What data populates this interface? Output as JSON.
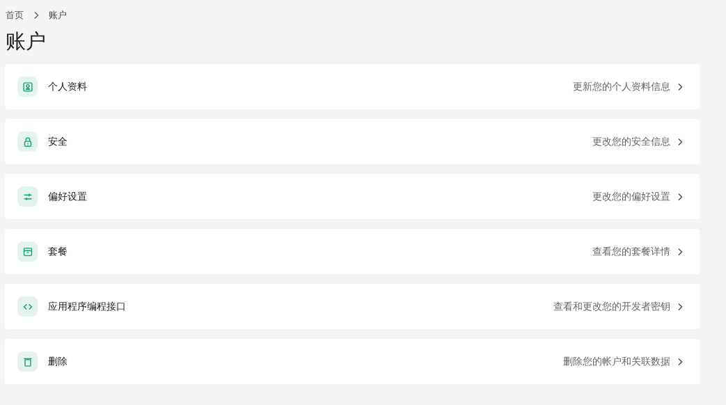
{
  "breadcrumb": [
    "首页",
    "账户"
  ],
  "title": "账户",
  "items": [
    {
      "kind": "profile",
      "label": "个人资料",
      "description": "更新您的个人资料信息"
    },
    {
      "kind": "security",
      "label": "安全",
      "description": "更改您的安全信息"
    },
    {
      "kind": "preferences",
      "label": "偏好设置",
      "description": "更改您的偏好设置"
    },
    {
      "kind": "plan",
      "label": "套餐",
      "description": "查看您的套餐详情"
    },
    {
      "kind": "api",
      "label": "应用程序编程接口",
      "description": "查看和更改您的开发者密钥"
    },
    {
      "kind": "delete",
      "label": "删除",
      "description": "删除您的帐户和关联数据"
    }
  ]
}
